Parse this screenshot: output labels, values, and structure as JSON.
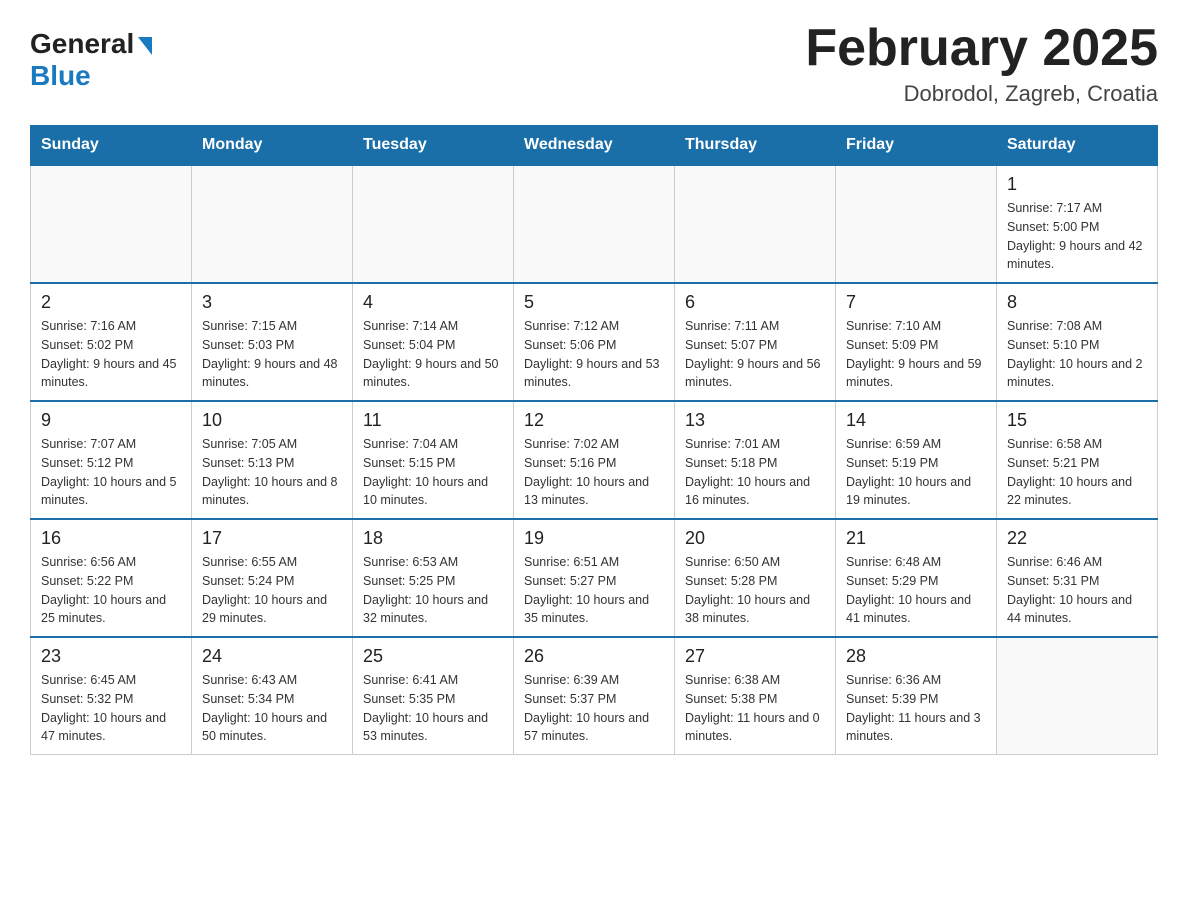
{
  "header": {
    "logo_general": "General",
    "logo_blue": "Blue",
    "month_title": "February 2025",
    "location": "Dobrodol, Zagreb, Croatia"
  },
  "weekdays": [
    "Sunday",
    "Monday",
    "Tuesday",
    "Wednesday",
    "Thursday",
    "Friday",
    "Saturday"
  ],
  "weeks": [
    [
      {
        "day": "",
        "sunrise": "",
        "sunset": "",
        "daylight": "",
        "empty": true
      },
      {
        "day": "",
        "sunrise": "",
        "sunset": "",
        "daylight": "",
        "empty": true
      },
      {
        "day": "",
        "sunrise": "",
        "sunset": "",
        "daylight": "",
        "empty": true
      },
      {
        "day": "",
        "sunrise": "",
        "sunset": "",
        "daylight": "",
        "empty": true
      },
      {
        "day": "",
        "sunrise": "",
        "sunset": "",
        "daylight": "",
        "empty": true
      },
      {
        "day": "",
        "sunrise": "",
        "sunset": "",
        "daylight": "",
        "empty": true
      },
      {
        "day": "1",
        "sunrise": "Sunrise: 7:17 AM",
        "sunset": "Sunset: 5:00 PM",
        "daylight": "Daylight: 9 hours and 42 minutes.",
        "empty": false
      }
    ],
    [
      {
        "day": "2",
        "sunrise": "Sunrise: 7:16 AM",
        "sunset": "Sunset: 5:02 PM",
        "daylight": "Daylight: 9 hours and 45 minutes.",
        "empty": false
      },
      {
        "day": "3",
        "sunrise": "Sunrise: 7:15 AM",
        "sunset": "Sunset: 5:03 PM",
        "daylight": "Daylight: 9 hours and 48 minutes.",
        "empty": false
      },
      {
        "day": "4",
        "sunrise": "Sunrise: 7:14 AM",
        "sunset": "Sunset: 5:04 PM",
        "daylight": "Daylight: 9 hours and 50 minutes.",
        "empty": false
      },
      {
        "day": "5",
        "sunrise": "Sunrise: 7:12 AM",
        "sunset": "Sunset: 5:06 PM",
        "daylight": "Daylight: 9 hours and 53 minutes.",
        "empty": false
      },
      {
        "day": "6",
        "sunrise": "Sunrise: 7:11 AM",
        "sunset": "Sunset: 5:07 PM",
        "daylight": "Daylight: 9 hours and 56 minutes.",
        "empty": false
      },
      {
        "day": "7",
        "sunrise": "Sunrise: 7:10 AM",
        "sunset": "Sunset: 5:09 PM",
        "daylight": "Daylight: 9 hours and 59 minutes.",
        "empty": false
      },
      {
        "day": "8",
        "sunrise": "Sunrise: 7:08 AM",
        "sunset": "Sunset: 5:10 PM",
        "daylight": "Daylight: 10 hours and 2 minutes.",
        "empty": false
      }
    ],
    [
      {
        "day": "9",
        "sunrise": "Sunrise: 7:07 AM",
        "sunset": "Sunset: 5:12 PM",
        "daylight": "Daylight: 10 hours and 5 minutes.",
        "empty": false
      },
      {
        "day": "10",
        "sunrise": "Sunrise: 7:05 AM",
        "sunset": "Sunset: 5:13 PM",
        "daylight": "Daylight: 10 hours and 8 minutes.",
        "empty": false
      },
      {
        "day": "11",
        "sunrise": "Sunrise: 7:04 AM",
        "sunset": "Sunset: 5:15 PM",
        "daylight": "Daylight: 10 hours and 10 minutes.",
        "empty": false
      },
      {
        "day": "12",
        "sunrise": "Sunrise: 7:02 AM",
        "sunset": "Sunset: 5:16 PM",
        "daylight": "Daylight: 10 hours and 13 minutes.",
        "empty": false
      },
      {
        "day": "13",
        "sunrise": "Sunrise: 7:01 AM",
        "sunset": "Sunset: 5:18 PM",
        "daylight": "Daylight: 10 hours and 16 minutes.",
        "empty": false
      },
      {
        "day": "14",
        "sunrise": "Sunrise: 6:59 AM",
        "sunset": "Sunset: 5:19 PM",
        "daylight": "Daylight: 10 hours and 19 minutes.",
        "empty": false
      },
      {
        "day": "15",
        "sunrise": "Sunrise: 6:58 AM",
        "sunset": "Sunset: 5:21 PM",
        "daylight": "Daylight: 10 hours and 22 minutes.",
        "empty": false
      }
    ],
    [
      {
        "day": "16",
        "sunrise": "Sunrise: 6:56 AM",
        "sunset": "Sunset: 5:22 PM",
        "daylight": "Daylight: 10 hours and 25 minutes.",
        "empty": false
      },
      {
        "day": "17",
        "sunrise": "Sunrise: 6:55 AM",
        "sunset": "Sunset: 5:24 PM",
        "daylight": "Daylight: 10 hours and 29 minutes.",
        "empty": false
      },
      {
        "day": "18",
        "sunrise": "Sunrise: 6:53 AM",
        "sunset": "Sunset: 5:25 PM",
        "daylight": "Daylight: 10 hours and 32 minutes.",
        "empty": false
      },
      {
        "day": "19",
        "sunrise": "Sunrise: 6:51 AM",
        "sunset": "Sunset: 5:27 PM",
        "daylight": "Daylight: 10 hours and 35 minutes.",
        "empty": false
      },
      {
        "day": "20",
        "sunrise": "Sunrise: 6:50 AM",
        "sunset": "Sunset: 5:28 PM",
        "daylight": "Daylight: 10 hours and 38 minutes.",
        "empty": false
      },
      {
        "day": "21",
        "sunrise": "Sunrise: 6:48 AM",
        "sunset": "Sunset: 5:29 PM",
        "daylight": "Daylight: 10 hours and 41 minutes.",
        "empty": false
      },
      {
        "day": "22",
        "sunrise": "Sunrise: 6:46 AM",
        "sunset": "Sunset: 5:31 PM",
        "daylight": "Daylight: 10 hours and 44 minutes.",
        "empty": false
      }
    ],
    [
      {
        "day": "23",
        "sunrise": "Sunrise: 6:45 AM",
        "sunset": "Sunset: 5:32 PM",
        "daylight": "Daylight: 10 hours and 47 minutes.",
        "empty": false
      },
      {
        "day": "24",
        "sunrise": "Sunrise: 6:43 AM",
        "sunset": "Sunset: 5:34 PM",
        "daylight": "Daylight: 10 hours and 50 minutes.",
        "empty": false
      },
      {
        "day": "25",
        "sunrise": "Sunrise: 6:41 AM",
        "sunset": "Sunset: 5:35 PM",
        "daylight": "Daylight: 10 hours and 53 minutes.",
        "empty": false
      },
      {
        "day": "26",
        "sunrise": "Sunrise: 6:39 AM",
        "sunset": "Sunset: 5:37 PM",
        "daylight": "Daylight: 10 hours and 57 minutes.",
        "empty": false
      },
      {
        "day": "27",
        "sunrise": "Sunrise: 6:38 AM",
        "sunset": "Sunset: 5:38 PM",
        "daylight": "Daylight: 11 hours and 0 minutes.",
        "empty": false
      },
      {
        "day": "28",
        "sunrise": "Sunrise: 6:36 AM",
        "sunset": "Sunset: 5:39 PM",
        "daylight": "Daylight: 11 hours and 3 minutes.",
        "empty": false
      },
      {
        "day": "",
        "sunrise": "",
        "sunset": "",
        "daylight": "",
        "empty": true
      }
    ]
  ]
}
